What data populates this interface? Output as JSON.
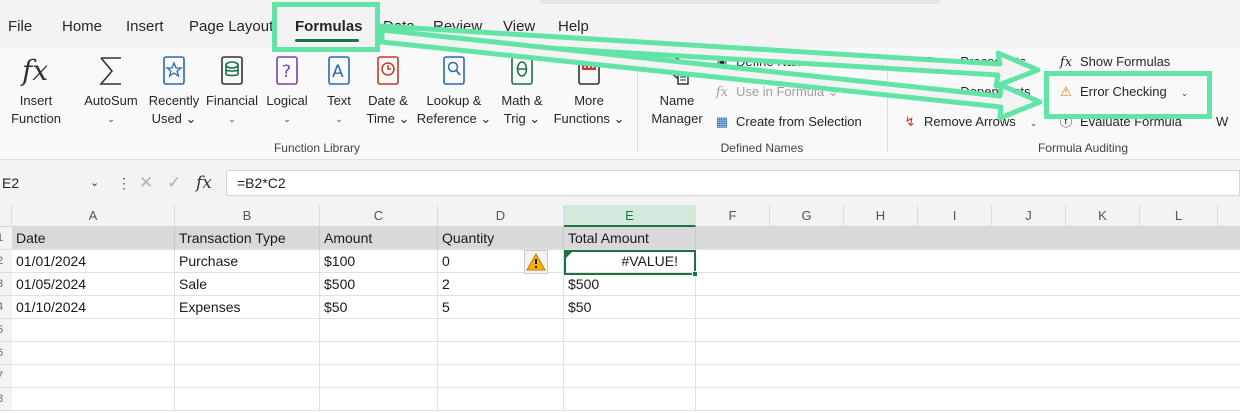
{
  "menu": {
    "file": "File",
    "home": "Home",
    "insert": "Insert",
    "page_layout": "Page Layout",
    "formulas": "Formulas",
    "data": "Data",
    "review": "Review",
    "view": "View",
    "help": "Help"
  },
  "ribbon": {
    "insert_function": [
      "Insert",
      "Function"
    ],
    "autosum": [
      "AutoSum",
      "⌄"
    ],
    "recently_used": [
      "Recently",
      "Used ⌄"
    ],
    "financial": [
      "Financial",
      "⌄"
    ],
    "logical": [
      "Logical",
      "⌄"
    ],
    "text": [
      "Text",
      "⌄"
    ],
    "date_time": [
      "Date &",
      "Time ⌄"
    ],
    "lookup_reference": [
      "Lookup &",
      "Reference ⌄"
    ],
    "math_trig": [
      "Math &",
      "Trig ⌄"
    ],
    "more_functions": [
      "More",
      "Functions ⌄"
    ],
    "function_library_label": "Function Library",
    "name_manager": [
      "Name",
      "Manager"
    ],
    "define_name": "Define Name ⌄",
    "use_in_formula": "Use in Formula ⌄",
    "create_from_selection": "Create from Selection",
    "defined_names_label": "Defined Names",
    "trace_precedents": "Trace Precedents",
    "trace_dependents": "Trace Dependents",
    "remove_arrows": "Remove Arrows",
    "show_formulas": "Show Formulas",
    "error_checking": "Error Checking",
    "evaluate_formula": "Evaluate Formula",
    "formula_auditing_label": "Formula Auditing",
    "watch_cutoff": "W"
  },
  "formula_bar": {
    "name_box": "E2",
    "formula": "=B2*C2"
  },
  "grid": {
    "columns": [
      "A",
      "B",
      "C",
      "D",
      "E",
      "F",
      "G",
      "H",
      "I",
      "J",
      "K",
      "L"
    ],
    "row_numbers": [
      "1",
      "2",
      "3",
      "4",
      "5",
      "6",
      "7",
      "8"
    ],
    "header_row": [
      "Date",
      "Transaction Type",
      "Amount",
      "Quantity",
      "Total Amount"
    ],
    "rows": [
      [
        "01/01/2024",
        "Purchase",
        "$100",
        "0",
        "#VALUE!"
      ],
      [
        "01/05/2024",
        "Sale",
        "$500",
        "2",
        "$500"
      ],
      [
        "01/10/2024",
        "Expenses",
        "$50",
        "5",
        "$50"
      ]
    ],
    "selected_cell": "E2"
  },
  "colors": {
    "accent": "#1e7145",
    "highlight": "#62e4a6"
  }
}
